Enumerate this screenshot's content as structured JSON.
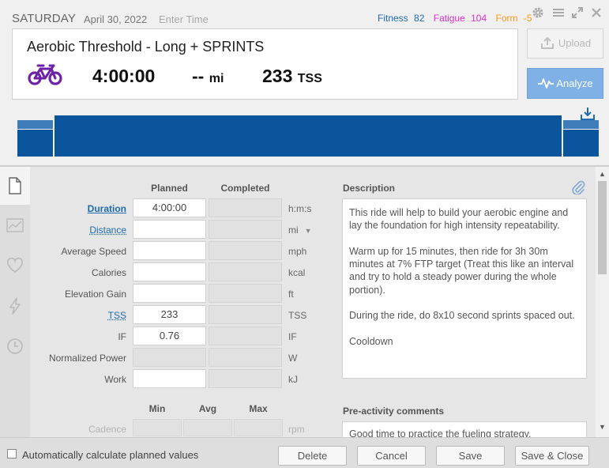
{
  "header": {
    "day": "SATURDAY",
    "date": "April 30, 2022",
    "time_placeholder": "Enter Time",
    "metrics": {
      "fitness_label": "Fitness",
      "fitness_value": "82",
      "fatigue_label": "Fatigue",
      "fatigue_value": "104",
      "form_label": "Form",
      "form_value": "-5"
    },
    "title": "Aerobic Threshold - Long + SPRINTS",
    "duration": "4:00:00",
    "distance_value": "--",
    "distance_unit": "mi",
    "tss_value": "233",
    "tss_unit": "TSS",
    "upload_label": "Upload",
    "analyze_label": "Analyze"
  },
  "colors": {
    "accent_blue": "#1e6bb0",
    "graph_blue": "#0a559c",
    "fitness": "#1e6bb0",
    "fatigue": "#e02fc8",
    "form": "#f29a17",
    "bike_purple": "#6e22a8",
    "analyze_button": "#7fb1e6"
  },
  "icons": {
    "settings": "gear-icon",
    "menu": "menu-icon",
    "expand": "expand-icon",
    "close": "close-icon",
    "sport": "bike-icon",
    "upload": "upload-icon",
    "analyze": "pulse-icon",
    "download": "download-icon",
    "attach": "paperclip-icon",
    "tabs": [
      "document-icon",
      "chart-icon",
      "heart-icon",
      "lightning-icon",
      "clock-icon"
    ]
  },
  "table": {
    "planned_header": "Planned",
    "completed_header": "Completed",
    "rows": [
      {
        "label": "Duration",
        "planned": "4:00:00",
        "unit": "h:m:s"
      },
      {
        "label": "Distance",
        "planned": "",
        "unit": "mi"
      },
      {
        "label": "Average Speed",
        "planned": "",
        "unit": "mph"
      },
      {
        "label": "Calories",
        "planned": "",
        "unit": "kcal"
      },
      {
        "label": "Elevation Gain",
        "planned": "",
        "unit": "ft"
      },
      {
        "label": "TSS",
        "planned": "233",
        "unit": "TSS"
      },
      {
        "label": "IF",
        "planned": "0.76",
        "unit": "IF"
      },
      {
        "label": "Normalized Power",
        "planned": "",
        "unit": "W"
      },
      {
        "label": "Work",
        "planned": "",
        "unit": "kJ"
      }
    ],
    "cadence": {
      "min_header": "Min",
      "avg_header": "Avg",
      "max_header": "Max",
      "label": "Cadence",
      "unit": "rpm"
    }
  },
  "description": {
    "heading": "Description",
    "paragraphs": [
      "This ride will help to build your aerobic engine and lay the foundation for high intensity repeatability.",
      "Warm up for 15 minutes, then ride for 3h 30m minutes at 7% FTP target (Treat this like an interval and try to hold a steady power during the whole portion).",
      "During the ride, do 8x10 second sprints spaced out.",
      "Cooldown"
    ]
  },
  "pre_activity": {
    "heading": "Pre-activity comments",
    "text": "Good time to practice the fueling strategy."
  },
  "footer": {
    "auto_calc_label": "Automatically calculate planned values",
    "delete_label": "Delete",
    "cancel_label": "Cancel",
    "save_label": "Save",
    "save_close_label": "Save & Close"
  }
}
